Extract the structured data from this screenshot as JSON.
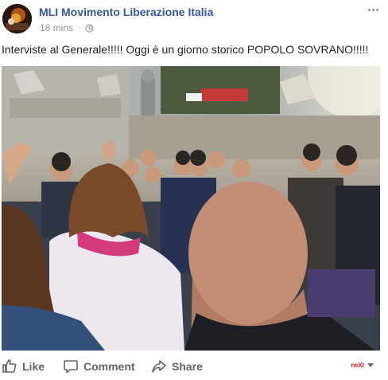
{
  "post": {
    "page_name": "MLI Movimento Liberazione Italia",
    "timestamp": "18 mins",
    "separator": "·",
    "privacy_icon": "globe-icon",
    "more_icon": "ellipsis-icon",
    "text": "Interviste al Generale!!!!! Oggi è un giorno storico POPOLO SOVRANO!!!!!",
    "photo_icon": "crowd-photo"
  },
  "actions": {
    "like_label": "Like",
    "comment_label": "Comment",
    "share_label": "Share",
    "like_icon": "thumbs-up-icon",
    "comment_icon": "speech-bubble-icon",
    "share_icon": "share-arrow-icon",
    "audience_selector_logo": "neXt",
    "audience_selector_icon": "chevron-down-icon"
  },
  "colors": {
    "name_link": "#365899",
    "meta_gray": "#90949c",
    "action_gray": "#606770",
    "text": "#1d2129"
  }
}
